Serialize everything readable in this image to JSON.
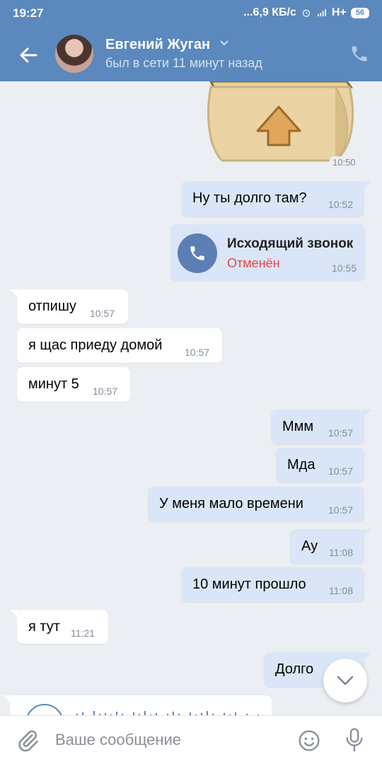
{
  "status_bar": {
    "time": "19:27",
    "network_speed": "...6,9 КБ/с",
    "signal": "H+",
    "battery": "56"
  },
  "header": {
    "contact_name": "Евгений Жуган",
    "contact_status": "был в сети 11 минут назад"
  },
  "sticker": {
    "time": "10:50"
  },
  "call": {
    "title": "Исходящий звонок",
    "status": "Отменён",
    "time": "10:55"
  },
  "messages": [
    {
      "dir": "out",
      "text": "Ну ты долго там?",
      "time": "10:52"
    },
    {
      "dir": "in",
      "text": "отпишу",
      "time": "10:57"
    },
    {
      "dir": "in",
      "text": "я щас приеду домой",
      "time": "10:57"
    },
    {
      "dir": "in",
      "text": "минут 5",
      "time": "10:57"
    },
    {
      "dir": "out",
      "text": "Ммм",
      "time": "10:57"
    },
    {
      "dir": "out",
      "text": "Мда",
      "time": "10:57"
    },
    {
      "dir": "out",
      "text": "У меня мало времени",
      "time": "10:57"
    },
    {
      "dir": "out",
      "text": "Ау",
      "time": "11:08"
    },
    {
      "dir": "out",
      "text": "10 минут прошло",
      "time": "11:08"
    },
    {
      "dir": "in",
      "text": "я тут",
      "time": "11:21"
    },
    {
      "dir": "out",
      "text": "Долго",
      "time": ""
    }
  ],
  "composer": {
    "placeholder": "Ваше сообщение"
  },
  "colors": {
    "header": "#5b88bd",
    "outgoing_bubble": "#dae6f7",
    "incoming_bubble": "#ffffff",
    "background": "#ebeef2",
    "cancelled": "#e64646"
  },
  "icons": [
    "back-arrow-icon",
    "phone-icon",
    "chevron-down-icon",
    "paperclip-icon",
    "emoji-icon",
    "microphone-icon"
  ]
}
